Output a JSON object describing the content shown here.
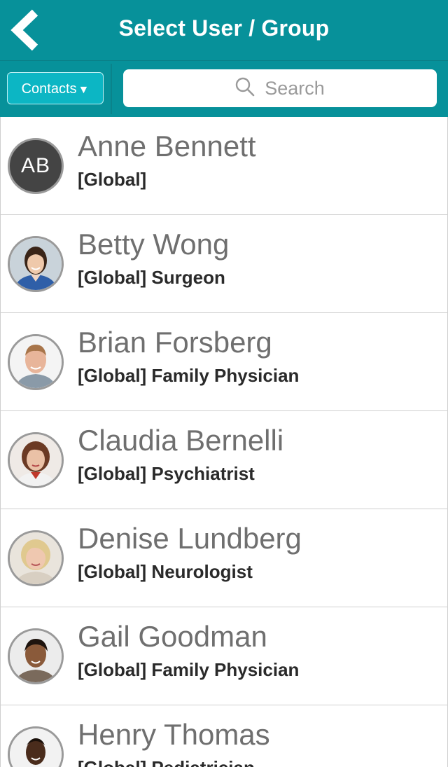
{
  "header": {
    "title": "Select User / Group",
    "back_icon": "chevron-left-icon"
  },
  "toolbar": {
    "contacts_label": "Contacts",
    "contacts_caret": "▼",
    "search": {
      "placeholder": "Search",
      "icon": "search-icon"
    }
  },
  "colors": {
    "header_bg": "#07919a",
    "contacts_button_bg": "#0cb6c4",
    "name_text": "#6f6f6f",
    "role_text": "#2a2a2a"
  },
  "contacts": [
    {
      "name": "Anne Bennett",
      "role": "[Global]",
      "initials": "AB"
    },
    {
      "name": "Betty Wong",
      "role": "[Global] Surgeon"
    },
    {
      "name": "Brian Forsberg",
      "role": "[Global] Family Physician"
    },
    {
      "name": "Claudia Bernelli",
      "role": "[Global] Psychiatrist"
    },
    {
      "name": "Denise Lundberg",
      "role": "[Global] Neurologist"
    },
    {
      "name": "Gail Goodman",
      "role": "[Global] Family Physician"
    },
    {
      "name": "Henry Thomas",
      "role": "[Global] Pediatrician"
    }
  ]
}
